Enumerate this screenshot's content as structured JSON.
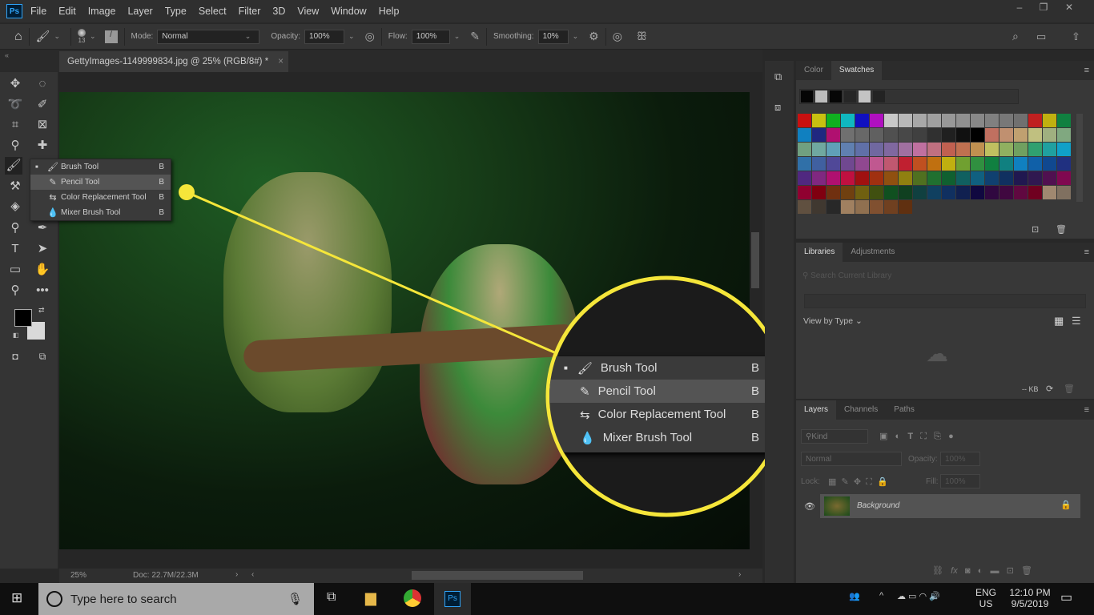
{
  "app": {
    "logo": "Ps",
    "menu": [
      "File",
      "Edit",
      "Image",
      "Layer",
      "Type",
      "Select",
      "Filter",
      "3D",
      "View",
      "Window",
      "Help"
    ]
  },
  "options": {
    "brush_size": "13",
    "mode_label": "Mode:",
    "mode": "Normal",
    "opacity_label": "Opacity:",
    "opacity": "100%",
    "flow_label": "Flow:",
    "flow": "100%",
    "smoothing_label": "Smoothing:",
    "smoothing": "10%"
  },
  "document": {
    "tab_title": "GettyImages-1149999834.jpg @ 25% (RGB/8#) *",
    "close": "×"
  },
  "status": {
    "zoom": "25%",
    "doc": "Doc: 22.7M/22.3M"
  },
  "flyout": {
    "items": [
      {
        "label": "Brush Tool",
        "key": "B",
        "icon": "brush-icon",
        "active": true
      },
      {
        "label": "Pencil Tool",
        "key": "B",
        "icon": "pencil-icon"
      },
      {
        "label": "Color Replacement Tool",
        "key": "B",
        "icon": "color-replacement-icon"
      },
      {
        "label": "Mixer Brush Tool",
        "key": "B",
        "icon": "mixer-brush-icon"
      }
    ]
  },
  "accent": "#f5e63a",
  "swatches_panel": {
    "tabs": [
      "Color",
      "Swatches"
    ],
    "active": "Swatches",
    "recent": [
      "#050505",
      "#bdbdbd",
      "#060606",
      "#262626",
      "#c4c4c4",
      "#232323"
    ],
    "colors": [
      "#c81010",
      "#c8c010",
      "#10b020",
      "#10b8c0",
      "#1010c0",
      "#b010c0",
      "#c8c8c8",
      "#b8b8b8",
      "#a8a8a8",
      "#a0a0a0",
      "#989898",
      "#909090",
      "#888888",
      "#808080",
      "#787878",
      "#707070",
      "#c02020",
      "#c0b010",
      "#108040",
      "#1080c0",
      "#202880",
      "#b01070",
      "#707070",
      "#686868",
      "#606060",
      "#505050",
      "#484848",
      "#404040",
      "#303030",
      "#202020",
      "#101010",
      "#000000",
      "#c07060",
      "#c09070",
      "#c0a070",
      "#c0c080",
      "#a0b080",
      "#80a880",
      "#70a080",
      "#70a8a0",
      "#60a0b8",
      "#6080b0",
      "#6070a8",
      "#7068a0",
      "#8068a0",
      "#a070a0",
      "#c070a0",
      "#c07080",
      "#c06050",
      "#c07050",
      "#c09050",
      "#c0c060",
      "#90b060",
      "#70a060",
      "#30a070",
      "#20a0a0",
      "#10a0c8",
      "#3070a8",
      "#4060a0",
      "#504898",
      "#704890",
      "#904890",
      "#c05890",
      "#c05870",
      "#c02030",
      "#c05020",
      "#c07010",
      "#c0b010",
      "#70a030",
      "#309040",
      "#108040",
      "#108080",
      "#1080c0",
      "#1060a8",
      "#104890",
      "#203080",
      "#502880",
      "#802880",
      "#b01070",
      "#c01040",
      "#a01010",
      "#a03010",
      "#905010",
      "#908010",
      "#507020",
      "#207030",
      "#106030",
      "#106060",
      "#106080",
      "#104070",
      "#103060",
      "#201850",
      "#301850",
      "#501050",
      "#800850",
      "#900030",
      "#800010",
      "#703010",
      "#704010",
      "#706010",
      "#405010",
      "#105020",
      "#104020",
      "#104040",
      "#104060",
      "#103060",
      "#102050",
      "#100840",
      "#300840",
      "#400840",
      "#600840",
      "#700020",
      "#a08870",
      "#807060",
      "#605040",
      "#403830",
      "#282828",
      "#a08060",
      "#907050",
      "#805030",
      "#704020",
      "#603010"
    ]
  },
  "libraries_panel": {
    "tabs": [
      "Libraries",
      "Adjustments"
    ],
    "search_placeholder": "Search Current Library",
    "view_by": "View by Type",
    "size": "-- KB"
  },
  "layers_panel": {
    "tabs": [
      "Layers",
      "Channels",
      "Paths"
    ],
    "filter": "Kind",
    "blend": "Normal",
    "opacity_label": "Opacity:",
    "opacity": "100%",
    "lock_label": "Lock:",
    "fill_label": "Fill:",
    "fill": "100%",
    "layers": [
      {
        "name": "Background",
        "visible": true,
        "locked": true
      }
    ]
  },
  "taskbar": {
    "search_placeholder": "Type here to search",
    "lang1": "ENG",
    "lang2": "US",
    "time": "12:10 PM",
    "date": "9/5/2019"
  }
}
